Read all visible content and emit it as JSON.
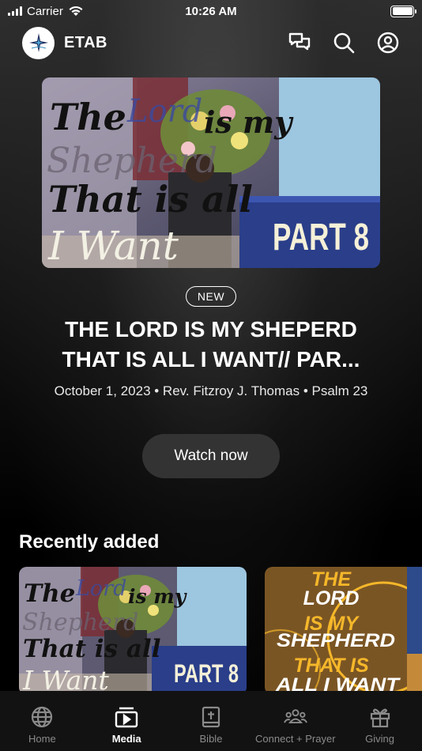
{
  "status_bar": {
    "carrier": "Carrier",
    "time": "10:26 AM"
  },
  "header": {
    "app_name": "ETAB"
  },
  "hero": {
    "thumbnail_text": {
      "line1": "The",
      "line1b": "Lord",
      "line1c": "is my",
      "line2": "Shepherd",
      "line3": "That is all",
      "line4": "I Want",
      "part": "PART 8"
    },
    "badge": "NEW",
    "title_line1": "THE LORD IS MY SHEPERD",
    "title_line2": "THAT IS ALL I WANT// PAR...",
    "meta": "October 1, 2023 • Rev. Fitzroy J. Thomas • Psalm 23",
    "watch_label": "Watch now"
  },
  "recently_added": {
    "title": "Recently added",
    "items": [
      {
        "thumbnail_text": {
          "line1": "The",
          "line1b": "Lord",
          "line1c": "is my",
          "line2": "Shepherd",
          "line3": "That is all",
          "line4": "I Want",
          "part": "PART 8"
        }
      },
      {
        "thumbnail_text": {
          "line1": "THE",
          "line2": "LORD",
          "line3": "IS MY",
          "line4": "SHEPHERD",
          "line5": "THAT IS",
          "line6": "ALL I WANT"
        }
      }
    ]
  },
  "tabs": [
    {
      "label": "Home",
      "icon": "globe-icon",
      "active": false
    },
    {
      "label": "Media",
      "icon": "play-library-icon",
      "active": true
    },
    {
      "label": "Bible",
      "icon": "bible-icon",
      "active": false
    },
    {
      "label": "Connect + Prayer",
      "icon": "people-icon",
      "active": false
    },
    {
      "label": "Giving",
      "icon": "gift-icon",
      "active": false
    }
  ],
  "colors": {
    "accent_yellow": "#f5b72a",
    "card2_brown": "#7a5524",
    "button_bg": "#333333",
    "tab_active": "#ffffff",
    "tab_inactive": "#8a8a8a"
  }
}
